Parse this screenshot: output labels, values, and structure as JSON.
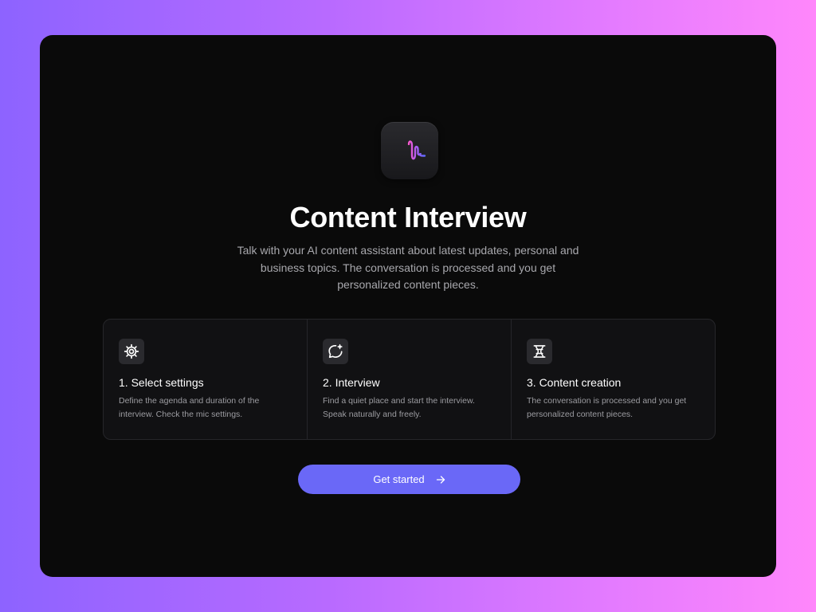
{
  "app": {
    "icon": "waveform-icon",
    "title": "Content Interview",
    "description": "Talk with your AI content assistant about latest updates, personal and business topics. The conversation is processed and you get personalized content pieces."
  },
  "steps": [
    {
      "icon": "gear-icon",
      "title": "1. Select settings",
      "description": "Define the agenda and duration of the interview. Check the mic settings."
    },
    {
      "icon": "chat-sparkle-icon",
      "title": "2. Interview",
      "description": "Find a quiet place and start the interview. Speak naturally and freely."
    },
    {
      "icon": "content-transform-icon",
      "title": "3. Content creation",
      "description": "The conversation is processed and you get personalized content pieces."
    }
  ],
  "cta": {
    "label": "Get started",
    "icon": "arrow-right-icon"
  },
  "colors": {
    "accent": "#6a68f7",
    "background_gradient_start": "#8d63ff",
    "background_gradient_end": "#ff87fb",
    "panel": "#0a0a0a"
  }
}
